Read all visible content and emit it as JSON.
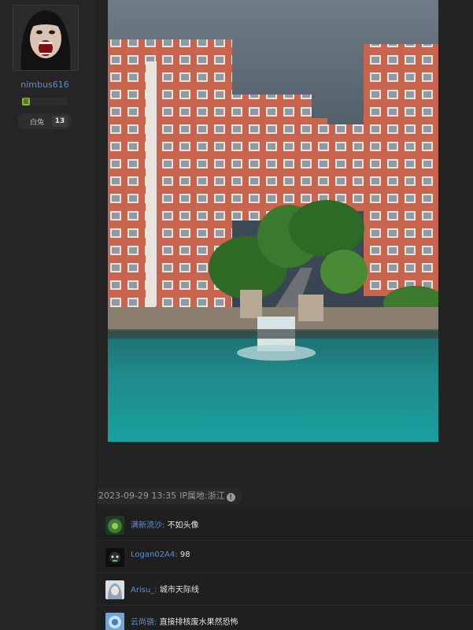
{
  "author": {
    "username": "nimbus616",
    "level_badge": "龍",
    "rank_name": "白兔",
    "rank_level": "13"
  },
  "post": {
    "timestamp": "2023-09-29 13:35",
    "location": "IP属地:浙江",
    "info_icon": "!"
  },
  "comments": [
    {
      "user": "满新流沙",
      "text": "不如头像",
      "avatar": "peacock-avatar"
    },
    {
      "user": "Logan02A4",
      "text": "98",
      "avatar": "dark-cartoon-avatar"
    },
    {
      "user": "Arisu_",
      "text": "城市天际线",
      "avatar": "anime-avatar"
    },
    {
      "user": "云尚骁",
      "text": "直接排核废水果然恐怖",
      "avatar": "blue-art-avatar"
    }
  ],
  "colors": {
    "username_blue": "#5f8fd0",
    "background": "#232323",
    "water": "#1f8a8a"
  }
}
